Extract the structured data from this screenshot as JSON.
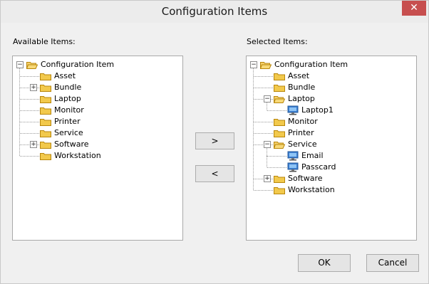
{
  "window": {
    "title": "Configuration Items",
    "close_label": "✕"
  },
  "available": {
    "label": "Available Items:",
    "root": "Configuration Item",
    "items": [
      {
        "label": "Asset",
        "expander": false
      },
      {
        "label": "Bundle",
        "expander": true
      },
      {
        "label": "Laptop",
        "expander": false
      },
      {
        "label": "Monitor",
        "expander": false
      },
      {
        "label": "Printer",
        "expander": false
      },
      {
        "label": "Service",
        "expander": false
      },
      {
        "label": "Software",
        "expander": true
      },
      {
        "label": "Workstation",
        "expander": false
      }
    ]
  },
  "selected": {
    "label": "Selected Items:",
    "root": "Configuration Item",
    "items": [
      {
        "label": "Asset"
      },
      {
        "label": "Bundle"
      },
      {
        "label": "Laptop",
        "children": [
          "Laptop1"
        ]
      },
      {
        "label": "Monitor"
      },
      {
        "label": "Printer"
      },
      {
        "label": "Service",
        "children": [
          "Email",
          "Passcard"
        ]
      },
      {
        "label": "Software",
        "expander": true
      },
      {
        "label": "Workstation"
      }
    ]
  },
  "buttons": {
    "add": ">",
    "remove": "<",
    "ok": "OK",
    "cancel": "Cancel"
  },
  "colors": {
    "folder": "#f2c94c",
    "close": "#c74f4f"
  }
}
